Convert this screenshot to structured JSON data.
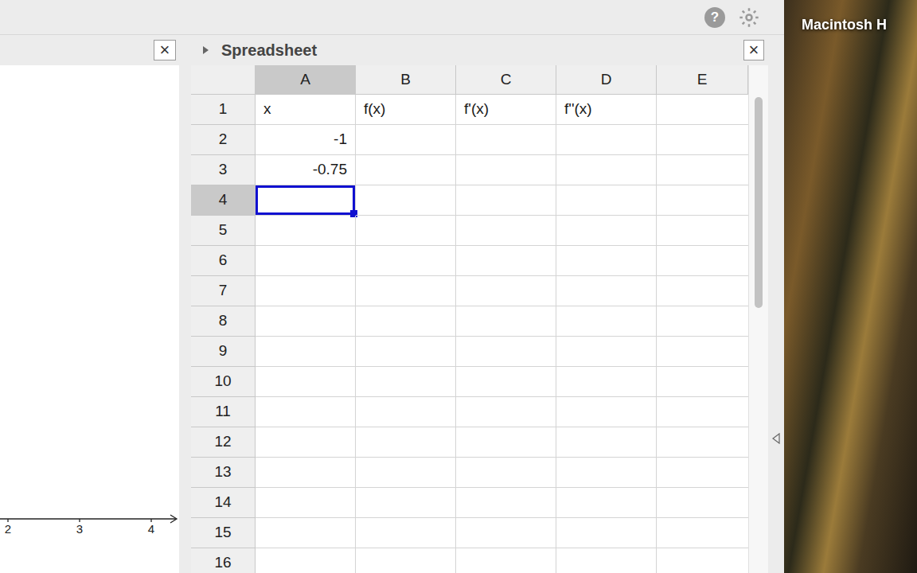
{
  "toolbar": {
    "help": "?"
  },
  "graphics_panel": {
    "close": "×",
    "axis": {
      "ticks": [
        "2",
        "3",
        "4"
      ]
    }
  },
  "spreadsheet": {
    "title": "Spreadsheet",
    "close": "×",
    "columns": [
      {
        "label": "A",
        "selected": true
      },
      {
        "label": "B",
        "selected": false
      },
      {
        "label": "C",
        "selected": false
      },
      {
        "label": "D",
        "selected": false
      },
      {
        "label": "E",
        "selected": false
      }
    ],
    "active_cell": {
      "row": "4",
      "column": "A"
    },
    "rows": [
      {
        "label": "1",
        "selected": false,
        "kind": "text",
        "cells": [
          "x",
          "f(x)",
          "f'(x)",
          "f''(x)",
          ""
        ]
      },
      {
        "label": "2",
        "selected": false,
        "kind": "number",
        "cells": [
          "-1",
          "",
          "",
          "",
          ""
        ]
      },
      {
        "label": "3",
        "selected": false,
        "kind": "number",
        "cells": [
          "-0.75",
          "",
          "",
          "",
          ""
        ]
      },
      {
        "label": "4",
        "selected": true,
        "kind": "text",
        "cells": [
          "",
          "",
          "",
          "",
          ""
        ]
      },
      {
        "label": "5",
        "selected": false,
        "kind": "text",
        "cells": [
          "",
          "",
          "",
          "",
          ""
        ]
      },
      {
        "label": "6",
        "selected": false,
        "kind": "text",
        "cells": [
          "",
          "",
          "",
          "",
          ""
        ]
      },
      {
        "label": "7",
        "selected": false,
        "kind": "text",
        "cells": [
          "",
          "",
          "",
          "",
          ""
        ]
      },
      {
        "label": "8",
        "selected": false,
        "kind": "text",
        "cells": [
          "",
          "",
          "",
          "",
          ""
        ]
      },
      {
        "label": "9",
        "selected": false,
        "kind": "text",
        "cells": [
          "",
          "",
          "",
          "",
          ""
        ]
      },
      {
        "label": "10",
        "selected": false,
        "kind": "text",
        "cells": [
          "",
          "",
          "",
          "",
          ""
        ]
      },
      {
        "label": "11",
        "selected": false,
        "kind": "text",
        "cells": [
          "",
          "",
          "",
          "",
          ""
        ]
      },
      {
        "label": "12",
        "selected": false,
        "kind": "text",
        "cells": [
          "",
          "",
          "",
          "",
          ""
        ]
      },
      {
        "label": "13",
        "selected": false,
        "kind": "text",
        "cells": [
          "",
          "",
          "",
          "",
          ""
        ]
      },
      {
        "label": "14",
        "selected": false,
        "kind": "text",
        "cells": [
          "",
          "",
          "",
          "",
          ""
        ]
      },
      {
        "label": "15",
        "selected": false,
        "kind": "text",
        "cells": [
          "",
          "",
          "",
          "",
          ""
        ]
      },
      {
        "label": "16",
        "selected": false,
        "kind": "text",
        "cells": [
          "",
          "",
          "",
          "",
          ""
        ]
      }
    ]
  },
  "desktop": {
    "label": "Macintosh H"
  }
}
